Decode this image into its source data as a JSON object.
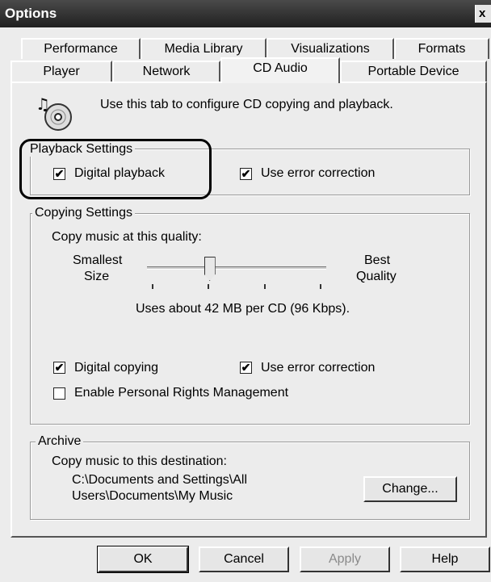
{
  "window": {
    "title": "Options",
    "close_glyph": "x"
  },
  "tabs_row_back": [
    "Performance",
    "Media Library",
    "Visualizations",
    "Formats"
  ],
  "tabs_row_front": [
    "Player",
    "Network",
    "CD Audio",
    "Portable Device"
  ],
  "active_tab": "CD Audio",
  "header": {
    "icon": "cd-music-icon",
    "text": "Use this tab to configure CD copying and playback."
  },
  "playback": {
    "title": "Playback Settings",
    "digital_playback": "Digital playback",
    "digital_playback_checked": true,
    "error_correction": "Use error correction",
    "error_correction_checked": true
  },
  "copying": {
    "title": "Copying Settings",
    "quality_label": "Copy music at this quality:",
    "slider_left_1": "Smallest",
    "slider_left_2": "Size",
    "slider_right_1": "Best",
    "slider_right_2": "Quality",
    "slider_position": 0.35,
    "usage_text": "Uses about 42 MB per CD (96 Kbps).",
    "digital_copying": "Digital copying",
    "digital_copying_checked": true,
    "error_correction": "Use error correction",
    "error_correction_checked": true,
    "prm": "Enable Personal Rights Management",
    "prm_checked": false
  },
  "archive": {
    "title": "Archive",
    "dest_label": "Copy music to this destination:",
    "path_line1": "C:\\Documents and Settings\\All",
    "path_line2": "Users\\Documents\\My Music",
    "change_button": "Change..."
  },
  "buttons": {
    "ok": "OK",
    "cancel": "Cancel",
    "apply": "Apply",
    "help": "Help"
  },
  "check_glyph": "✔"
}
